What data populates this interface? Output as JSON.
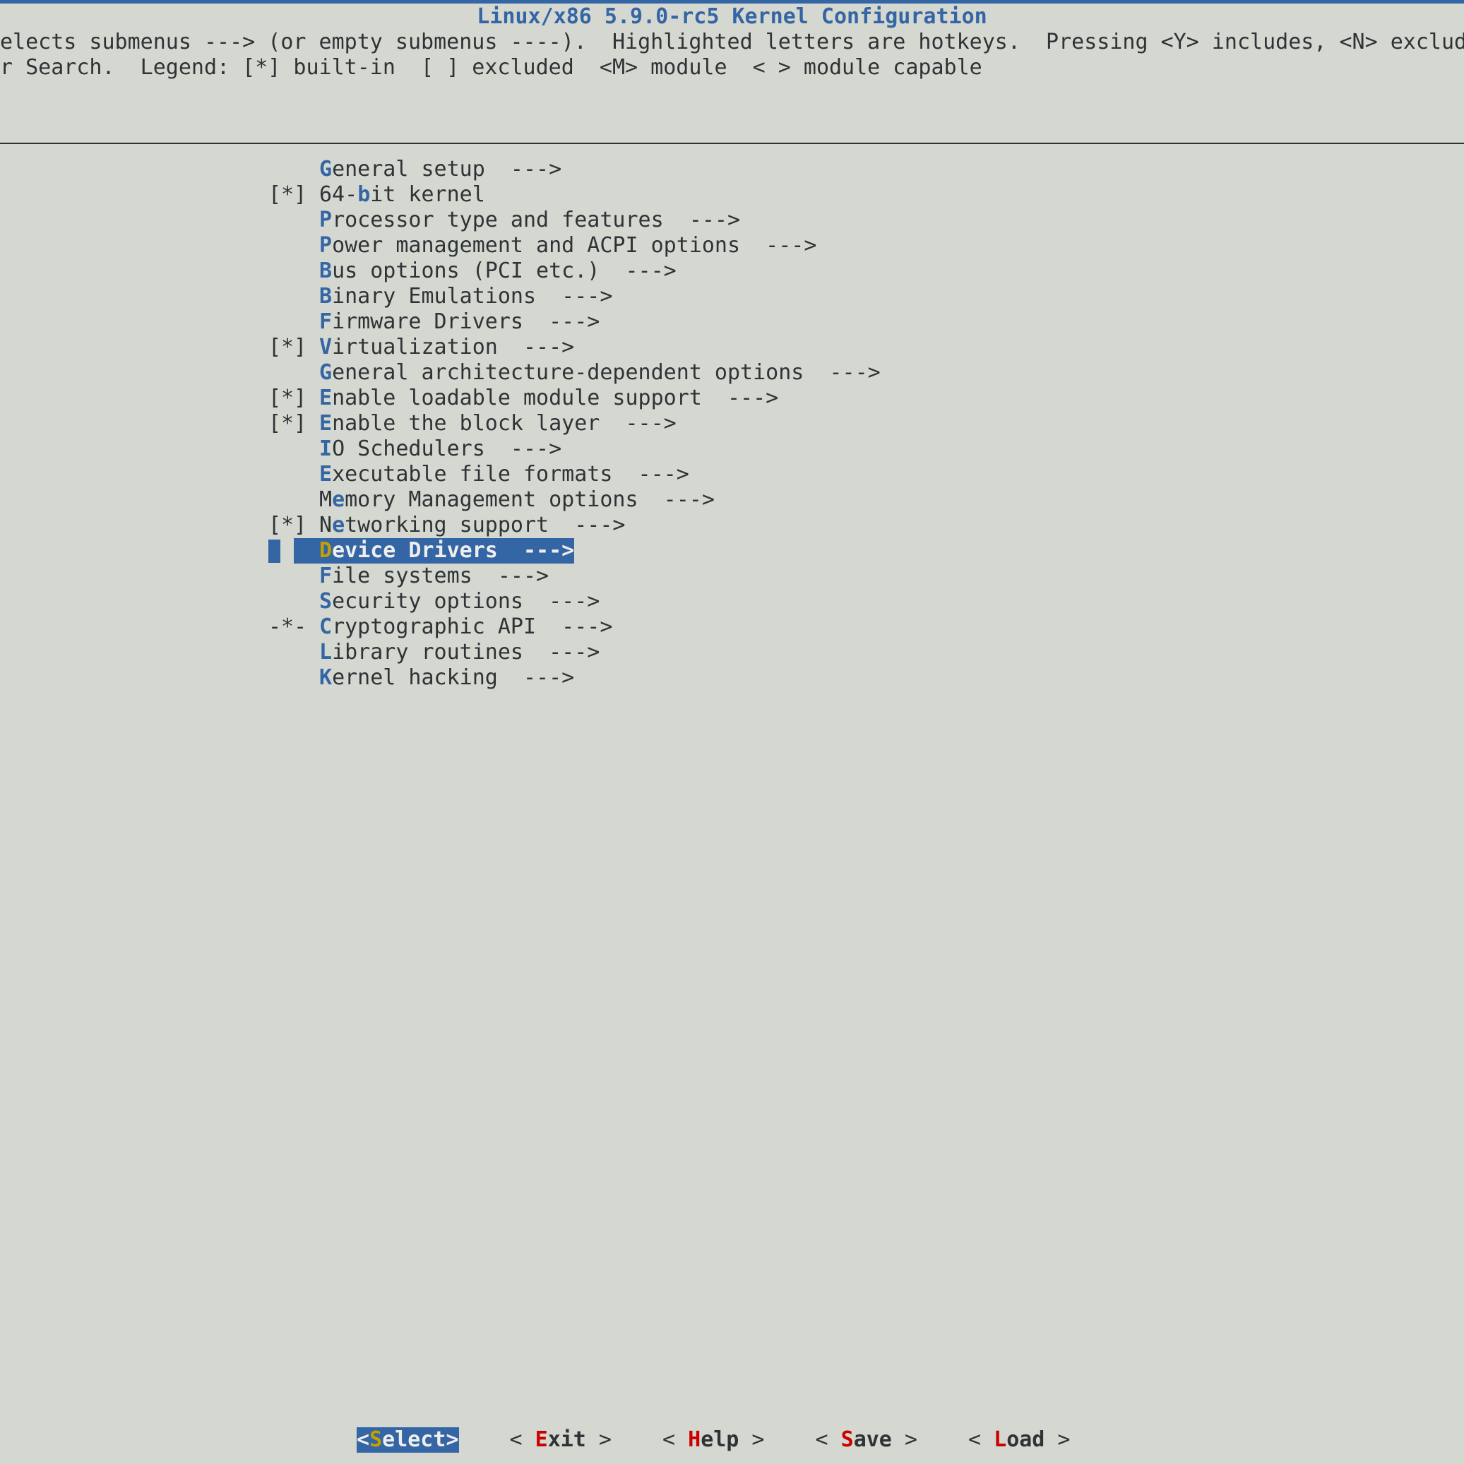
{
  "title": "Linux/x86 5.9.0-rc5 Kernel Configuration",
  "help_line_1": "elects submenus ---> (or empty submenus ----).  Highlighted letters are hotkeys.  Pressing <Y> includes, <N> exclud",
  "help_line_2": "r Search.  Legend: [*] built-in  [ ] excluded  <M> module  < > module capable",
  "menu_items": [
    {
      "prefix": "",
      "pre": "",
      "hotkey": "G",
      "post": "eneral setup  --->"
    },
    {
      "prefix": "[*]",
      "pre": "64-",
      "hotkey": "b",
      "post": "it kernel"
    },
    {
      "prefix": "",
      "pre": "",
      "hotkey": "P",
      "post": "rocessor type and features  --->"
    },
    {
      "prefix": "",
      "pre": "",
      "hotkey": "P",
      "post": "ower management and ACPI options  --->"
    },
    {
      "prefix": "",
      "pre": "",
      "hotkey": "B",
      "post": "us options (PCI etc.)  --->"
    },
    {
      "prefix": "",
      "pre": "",
      "hotkey": "B",
      "post": "inary Emulations  --->"
    },
    {
      "prefix": "",
      "pre": "",
      "hotkey": "F",
      "post": "irmware Drivers  --->"
    },
    {
      "prefix": "[*]",
      "pre": "",
      "hotkey": "V",
      "post": "irtualization  --->"
    },
    {
      "prefix": "",
      "pre": "",
      "hotkey": "G",
      "post": "eneral architecture-dependent options  --->"
    },
    {
      "prefix": "[*]",
      "pre": "",
      "hotkey": "E",
      "post": "nable loadable module support  --->"
    },
    {
      "prefix": "[*]",
      "pre": "",
      "hotkey": "E",
      "post": "nable the block layer  --->"
    },
    {
      "prefix": "",
      "pre": "",
      "hotkey": "I",
      "post": "O Schedulers  --->"
    },
    {
      "prefix": "",
      "pre": "",
      "hotkey": "E",
      "post": "xecutable file formats  --->"
    },
    {
      "prefix": "",
      "pre": "M",
      "hotkey": "e",
      "post": "mory Management options  --->"
    },
    {
      "prefix": "[*]",
      "pre": "N",
      "hotkey": "e",
      "post": "tworking support  --->"
    },
    {
      "prefix": "",
      "pre": "",
      "hotkey": "D",
      "post": "evice Drivers  --->",
      "selected": true
    },
    {
      "prefix": "",
      "pre": "",
      "hotkey": "F",
      "post": "ile systems  --->"
    },
    {
      "prefix": "",
      "pre": "",
      "hotkey": "S",
      "post": "ecurity options  --->"
    },
    {
      "prefix": "-*-",
      "pre": "",
      "hotkey": "C",
      "post": "ryptographic API  --->"
    },
    {
      "prefix": "",
      "pre": "",
      "hotkey": "L",
      "post": "ibrary routines  --->"
    },
    {
      "prefix": "",
      "pre": "",
      "hotkey": "K",
      "post": "ernel hacking  --->"
    }
  ],
  "buttons": [
    {
      "name": "select-button",
      "left": "<",
      "hotkey": "S",
      "rest": "elect",
      "right": ">",
      "selected": true
    },
    {
      "name": "exit-button",
      "left": "< ",
      "hotkey": "E",
      "rest": "xit",
      "right": " >"
    },
    {
      "name": "help-button",
      "left": "< ",
      "hotkey": "H",
      "rest": "elp",
      "right": " >"
    },
    {
      "name": "save-button",
      "left": "< ",
      "hotkey": "S",
      "rest": "ave",
      "right": " >"
    },
    {
      "name": "load-button",
      "left": "< ",
      "hotkey": "L",
      "rest": "oad",
      "right": " >"
    }
  ]
}
